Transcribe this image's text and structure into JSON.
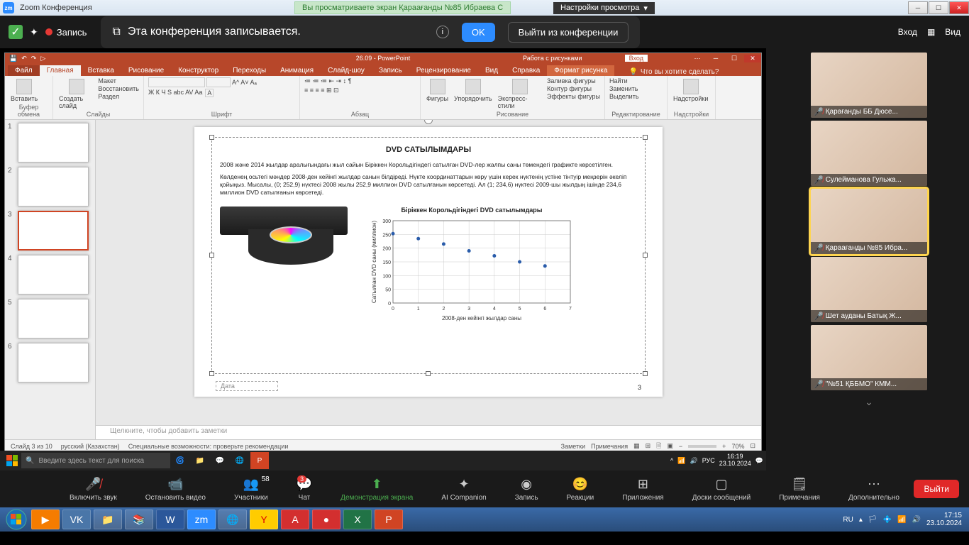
{
  "zoom_title": "Zoom Конференция",
  "sharing_banner": "Вы просматриваете экран Қараағанды №85 Ибраева С",
  "view_settings": "Настройки просмотра",
  "recording_label": "Запись",
  "recording_banner_text": "Эта конференция записывается.",
  "ok_label": "OK",
  "leave_label": "Выйти из конференции",
  "enter_label": "Вход",
  "view_label": "Вид",
  "participants_count": "58",
  "chat_badge": "3",
  "participants": [
    {
      "name": "Қарағанды ББ Дюсе..."
    },
    {
      "name": "Сулейманова Гульжа..."
    },
    {
      "name": "Қараағанды №85 Ибра...",
      "active": true
    },
    {
      "name": "Шет ауданы Батық Ж..."
    },
    {
      "name": "\"№51 ҚББМО\" КММ..."
    }
  ],
  "zoom_tools": {
    "audio": "Включить звук",
    "video": "Остановить видео",
    "participants": "Участники",
    "chat": "Чат",
    "share": "Демонстрация экрана",
    "ai": "AI Companion",
    "record": "Запись",
    "reactions": "Реакции",
    "apps": "Приложения",
    "whiteboard": "Доски сообщений",
    "notes": "Примечания",
    "more": "Дополнительно",
    "exit": "Выйти"
  },
  "ppt": {
    "doc_title": "26.09 - PowerPoint",
    "context_title": "Работа с рисунками",
    "signin": "Вход",
    "tabs": {
      "file": "Файл",
      "home": "Главная",
      "insert": "Вставка",
      "draw": "Рисование",
      "design": "Конструктор",
      "transitions": "Переходы",
      "animations": "Анимация",
      "slideshow": "Слайд-шоу",
      "record": "Запись",
      "review": "Рецензирование",
      "view": "Вид",
      "help": "Справка",
      "format": "Формат рисунка",
      "tellme": "Что вы хотите сделать?"
    },
    "ribbon_groups": {
      "clipboard": "Буфер обмена",
      "slides": "Слайды",
      "font": "Шрифт",
      "paragraph": "Абзац",
      "drawing": "Рисование",
      "editing": "Редактирование",
      "addins": "Надстройки"
    },
    "ribbon_btns": {
      "paste": "Вставить",
      "new_slide": "Создать слайд",
      "layout": "Макет",
      "reset": "Восстановить",
      "section": "Раздел",
      "shapes": "Фигуры",
      "arrange": "Упорядочить",
      "quick_styles": "Экспресс-стили",
      "shape_fill": "Заливка фигуры",
      "shape_outline": "Контур фигуры",
      "shape_effects": "Эффекты фигуры",
      "find": "Найти",
      "replace": "Заменить",
      "select": "Выделить",
      "addins_btn": "Надстройки"
    },
    "slide_content": {
      "title": "DVD САТЫЛЫМДАРЫ",
      "p1": "2008 және 2014 жылдар аралығындағы жыл сайын Біріккен Корольдігіндегі сатылған DVD-лер жалпы саны төмендегі графикте көрсетілген.",
      "p2": "Көлденең осьтегі мәндер 2008-ден кейінгі жылдар санын білдіреді. Нүкте координаттарын көру үшін керек нүктенің үстіне тінтуір меңзерін әкеліп қойыңыз. Мысалы, (0; 252,9) нүктесі 2008 жылы 252,9 миллион DVD сатылғанын көрсетеді. Ал (1; 234,6) нүктесі 2009-шы жылдың ішінде 234,6 миллион DVD сатылғанын көрсетеді.",
      "date_placeholder": "Дата",
      "page": "3"
    },
    "notes_placeholder": "Щелкните, чтобы добавить заметки",
    "status": {
      "slide": "Слайд 3 из 10",
      "lang": "русский (Казахстан)",
      "access": "Специальные возможности: проверьте рекомендации",
      "notes": "Заметки",
      "comments": "Примечания",
      "zoom": "70%"
    }
  },
  "chart_data": {
    "type": "scatter",
    "title": "Біріккен Корольдігіндегі DVD сатылымдары",
    "xlabel": "2008-ден кейінгі жылдар саны",
    "ylabel": "Сатылған DVD саны (миллион)",
    "xlim": [
      0,
      7
    ],
    "ylim": [
      0,
      300
    ],
    "x_ticks": [
      0,
      1,
      2,
      3,
      4,
      5,
      6,
      7
    ],
    "y_ticks": [
      0,
      50,
      100,
      150,
      200,
      250,
      300
    ],
    "x": [
      0,
      1,
      2,
      3,
      4,
      5,
      6
    ],
    "y": [
      252.9,
      234.6,
      215,
      190,
      172,
      150,
      135
    ]
  },
  "inner_taskbar": {
    "search_placeholder": "Введите здесь текст для поиска",
    "lang": "РУС",
    "time": "16:19",
    "date": "23.10.2024"
  },
  "outer_taskbar": {
    "lang": "RU",
    "time": "17:15",
    "date": "23.10.2024"
  }
}
